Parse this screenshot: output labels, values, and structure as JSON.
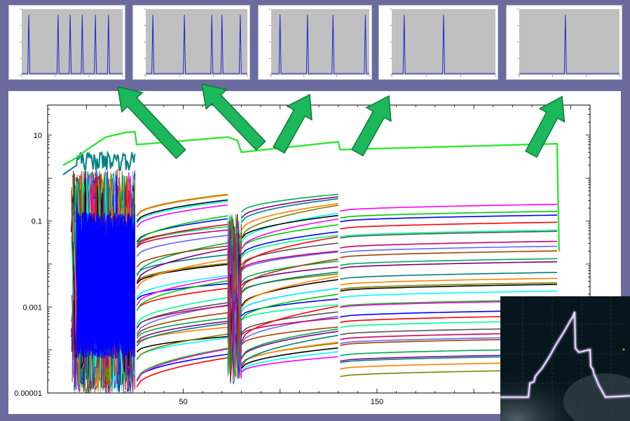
{
  "colors": {
    "background": "#6b6b9e",
    "thumbnail_plot": "#c0c0c0",
    "thumbnail_peak": "#2323d0",
    "arrow_fill": "#1cb85c",
    "arrow_stroke": "#0d7a39",
    "top_trace": "#2ee82e",
    "teal_trace": "#008080",
    "palette": [
      "#ff0000",
      "#0000ff",
      "#00cc00",
      "#ff00ff",
      "#00ffff",
      "#000000",
      "#808000",
      "#ff8000",
      "#008080",
      "#800080",
      "#00aa55",
      "#994400",
      "#6666ff",
      "#cc0066",
      "#555555",
      "#00ff99"
    ]
  },
  "thumbnails": [
    {
      "peaks": [
        0.07,
        0.36,
        0.48,
        0.6,
        0.73,
        0.86
      ]
    },
    {
      "peaks": [
        0.07,
        0.38,
        0.65,
        0.75,
        0.93
      ]
    },
    {
      "peaks": [
        0.09,
        0.37,
        0.63,
        0.96
      ]
    },
    {
      "peaks": [
        0.12,
        0.5
      ]
    },
    {
      "peaks": [
        0.46
      ]
    }
  ],
  "chart_data": {
    "type": "line",
    "y_scale": "log",
    "ylim": [
      1e-05,
      50
    ],
    "xlim": [
      -20,
      260
    ],
    "y_tick_labels": [
      "10",
      "0.1",
      "0.001",
      "0.00001"
    ],
    "y_tick_values": [
      10,
      0.1,
      0.001,
      1e-05
    ],
    "x_tick_labels": [
      "50",
      "150"
    ],
    "x_tick_values": [
      50,
      150
    ],
    "segments": [
      {
        "x0": 26,
        "x1": 73,
        "n_lines": 40,
        "top_start": 6,
        "top_end": 9
      },
      {
        "x0": 80,
        "x1": 130,
        "n_lines": 40,
        "top_start": 7,
        "top_end": 7
      },
      {
        "x0": 131,
        "x1": 243,
        "n_lines": 30,
        "top_start": 4.6,
        "top_end": 6.3
      }
    ],
    "top_series": [
      [
        -12,
        2.0
      ],
      [
        -5,
        3.0
      ],
      [
        0,
        4.5
      ],
      [
        10,
        9.0
      ],
      [
        20,
        11.5
      ],
      [
        25,
        12.0
      ],
      [
        26,
        6.0
      ],
      [
        73,
        9.0
      ],
      [
        78,
        7.5
      ],
      [
        80,
        4.0
      ],
      [
        130,
        7.0
      ],
      [
        131,
        4.6
      ],
      [
        243,
        6.3
      ],
      [
        244,
        0.02
      ]
    ]
  }
}
